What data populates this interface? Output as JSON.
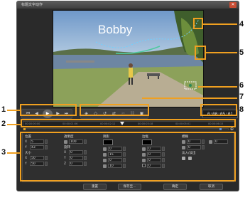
{
  "window": {
    "title": "标题文字动作"
  },
  "preview": {
    "overlay_title": "Bobby"
  },
  "playback": {
    "buttons": [
      "home-icon",
      "prev-frame-icon",
      "play-icon",
      "next-frame-icon",
      "end-icon"
    ],
    "timecode": "0:00:05:01"
  },
  "keyframe_tools": [
    "add-keyframe-icon",
    "remove-keyframe-icon",
    "reverse-icon",
    "swap-icon",
    "cut-icon",
    "link-icon",
    "fit-icon"
  ],
  "ruler": {
    "ticks": [
      "00:00:00:00",
      "00:00:01:06",
      "00:00:02:12",
      "00:00:03:18",
      "00:00:05:01",
      "00:00:06:15"
    ]
  },
  "attributes": {
    "position": {
      "header": "位置",
      "x_label": "X",
      "x_value": "5",
      "y_label": "Y",
      "y_value": "43",
      "size_header": "大小",
      "sx_label": "X",
      "sx_value": "50",
      "sy_label": "Y",
      "sy_value": "50"
    },
    "opacity": {
      "header": "透明度",
      "value": "100",
      "rotation_header": "旋转",
      "rx_label": "X",
      "rx_value": "0",
      "ry_label": "Y",
      "ry_value": "0",
      "rz_label": "Z",
      "rz_value": "0"
    },
    "shadow": {
      "header": "阴影",
      "values": [
        "0",
        "15",
        "0",
        "10"
      ]
    },
    "border": {
      "header": "边框",
      "values": [
        "0",
        "0",
        "0",
        "0"
      ]
    },
    "blur": {
      "header": "模糊",
      "v1": "0",
      "v2": "0",
      "v3": "0",
      "fade_header": "淡入/淡出"
    }
  },
  "footer": {
    "reset": "重置",
    "save_as": "保存至...",
    "ok": "确定",
    "cancel": "取消"
  },
  "callouts": [
    "1",
    "2",
    "3",
    "4",
    "5",
    "6",
    "7",
    "8"
  ],
  "colors": {
    "accent": "#f0a020",
    "window_bg": "#2a2a2a"
  }
}
